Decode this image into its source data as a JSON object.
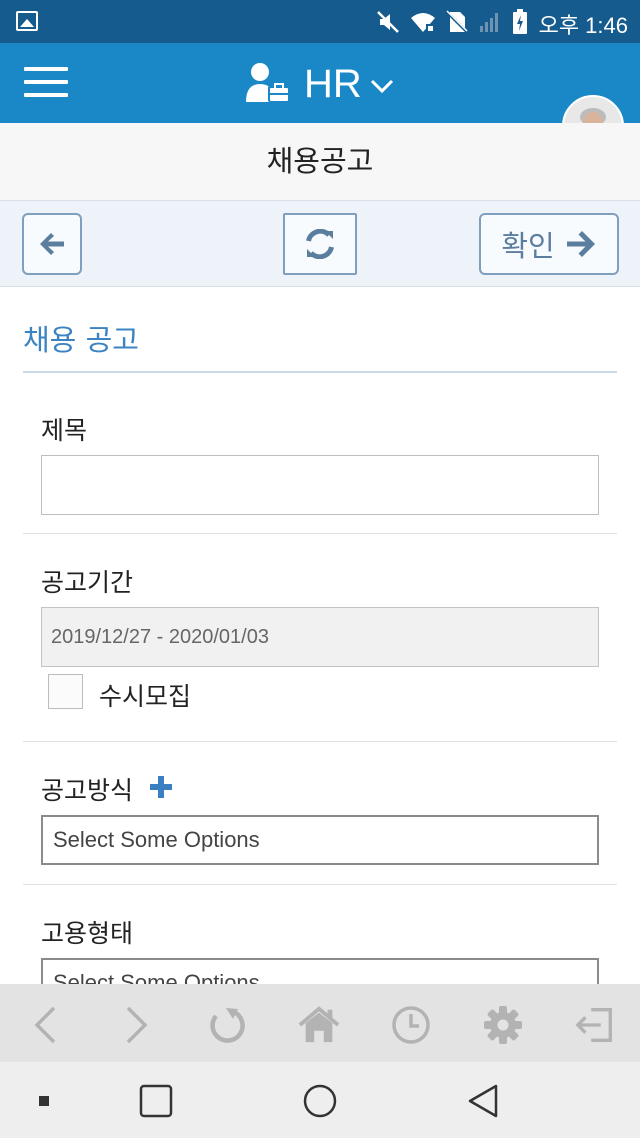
{
  "status_bar": {
    "time": "오후 1:46",
    "icons": [
      "gallery-icon",
      "mute-icon",
      "wifi-icon",
      "no-sim-icon",
      "signal-icon",
      "battery-icon"
    ]
  },
  "app": {
    "title": "HR",
    "brand_icon": "user-briefcase-icon"
  },
  "page_title": "채용공고",
  "toolbar": {
    "confirm_label": "확인"
  },
  "form": {
    "section_title": "채용 공고",
    "title_label": "제목",
    "title_value": "",
    "period_label": "공고기간",
    "period_value": "2019/12/27 - 2020/01/03",
    "rolling_label": "수시모집",
    "rolling_checked": false,
    "method_label": "공고방식",
    "method_placeholder": "Select Some Options",
    "employment_label": "고용형태",
    "employment_placeholder": "Select Some Options"
  },
  "browser_toolbar": [
    "back-icon",
    "forward-icon",
    "reload-icon",
    "home-icon",
    "history-icon",
    "settings-icon",
    "logout-icon"
  ],
  "colors": {
    "status_bar": "#165b8e",
    "app_bar": "#1a87c6",
    "accent": "#3b83c2",
    "button_border": "#7e9fbf"
  }
}
